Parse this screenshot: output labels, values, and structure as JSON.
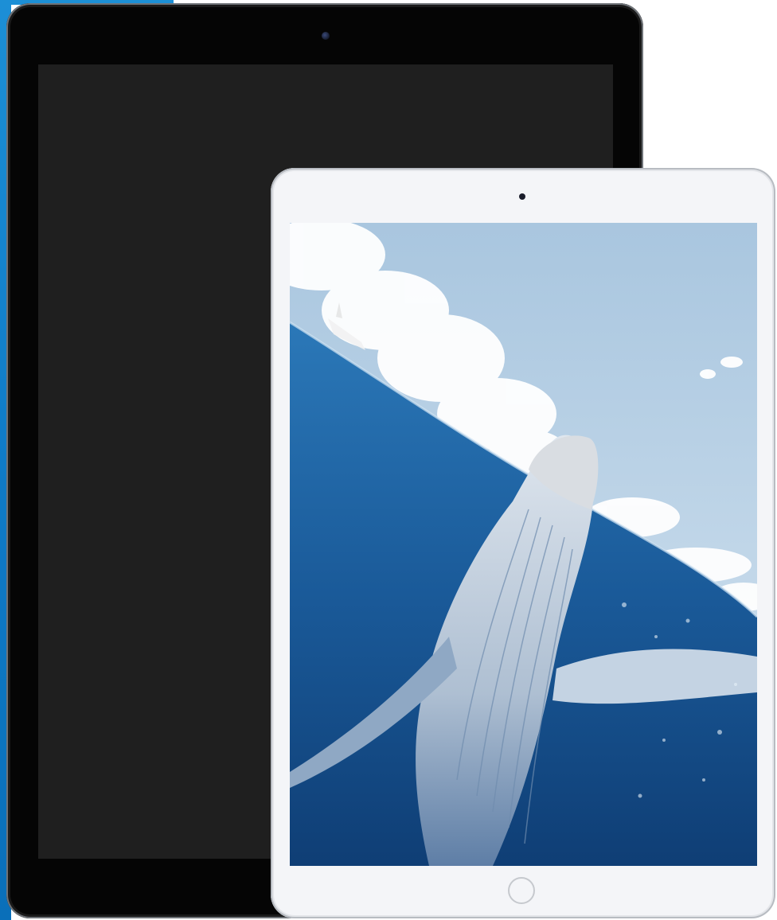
{
  "devices": {
    "large_tablet": {
      "color": "#050505",
      "screen_color": "#1f1f1f"
    },
    "small_tablet": {
      "color": "#f4f5f8",
      "wallpaper": "humpback-whale-underwater-split-view"
    }
  },
  "colors": {
    "accent": "#1c8fd6",
    "sky": "#b9d3e8",
    "ocean": "#1d5f9c"
  }
}
